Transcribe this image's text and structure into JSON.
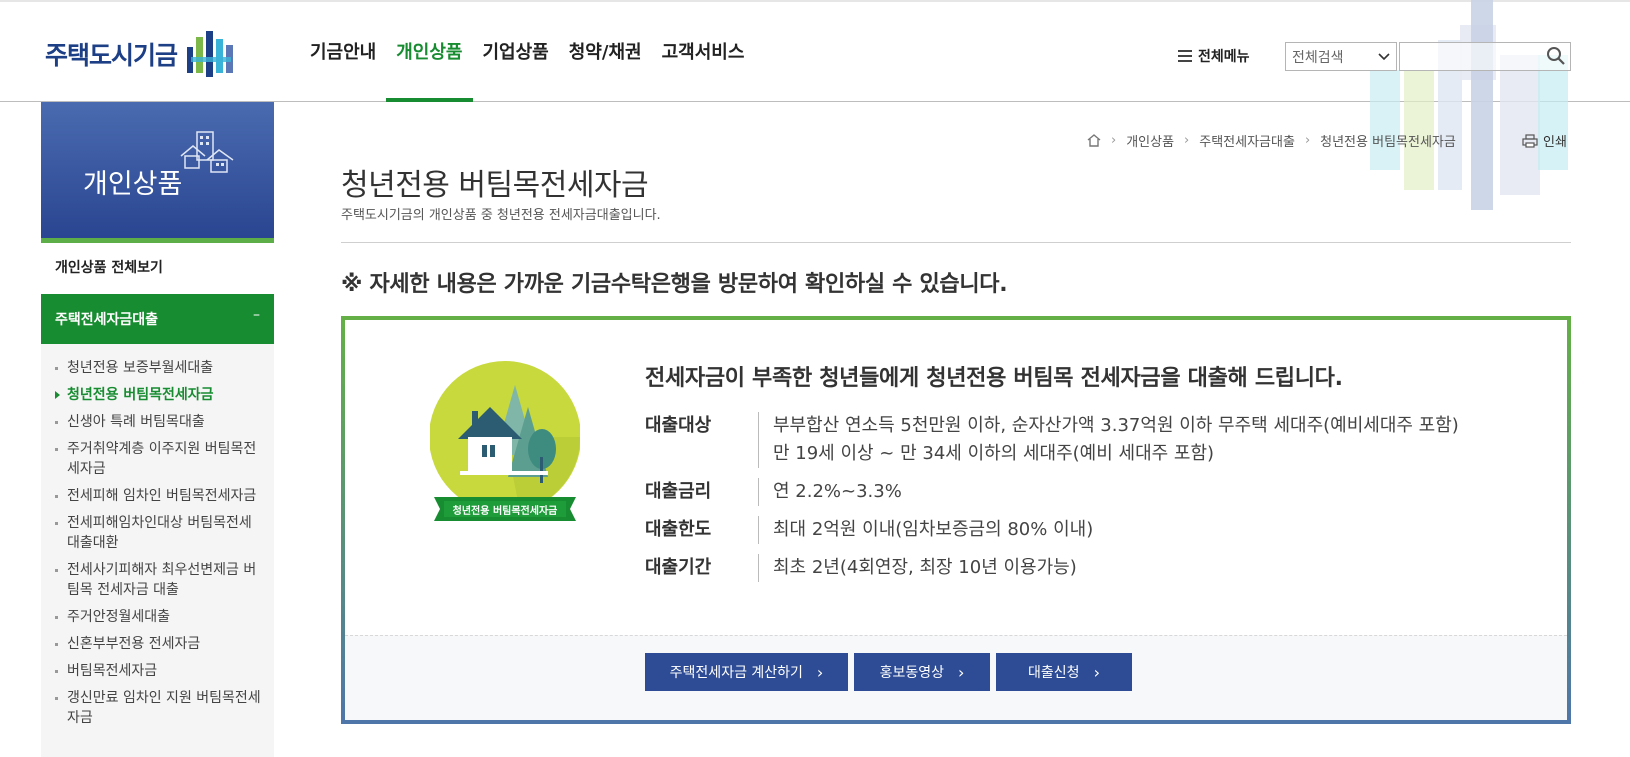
{
  "logo": {
    "text": "주택도시기금"
  },
  "gnb": [
    {
      "label": "기금안내"
    },
    {
      "label": "개인상품"
    },
    {
      "label": "기업상품"
    },
    {
      "label": "청약/채권"
    },
    {
      "label": "고객서비스"
    }
  ],
  "header": {
    "all_menu": "전체메뉴",
    "search_select": "전체검색",
    "search_placeholder": ""
  },
  "sidebar": {
    "title": "개인상품",
    "view_all": "개인상품 전체보기",
    "category": "주택전세자금대출",
    "category_toggle": "–",
    "items": [
      {
        "label": "청년전용 보증부월세대출"
      },
      {
        "label": "청년전용 버팀목전세자금"
      },
      {
        "label": "신생아 특례 버팀목대출"
      },
      {
        "label": "주거취약계층 이주지원 버팀목전세자금"
      },
      {
        "label": "전세피해 임차인 버팀목전세자금"
      },
      {
        "label": "전세피해임차인대상 버팀목전세대출대환"
      },
      {
        "label": "전세사기피해자 최우선변제금 버팀목 전세자금 대출"
      },
      {
        "label": "주거안정월세대출"
      },
      {
        "label": "신혼부부전용 전세자금"
      },
      {
        "label": "버팀목전세자금"
      },
      {
        "label": "갱신만료 임차인 지원 버팀목전세자금"
      }
    ]
  },
  "breadcrumb": [
    "개인상품",
    "주택전세자금대출",
    "청년전용 버팀목전세자금"
  ],
  "print_label": "인쇄",
  "page": {
    "title": "청년전용 버팀목전세자금",
    "desc": "주택도시기금의 개인상품 중 청년전용 전세자금대출입니다.",
    "notice": "※ 자세한 내용은 가까운 기금수탁은행을 방문하여 확인하실 수 있습니다."
  },
  "product": {
    "emblem_text": "청년전용 버팀목전세자금",
    "headline": "전세자금이 부족한 청년들에게 청년전용 버팀목 전세자금을 대출해 드립니다.",
    "rows": [
      {
        "label": "대출대상",
        "value1": "부부합산 연소득 5천만원 이하, 순자산가액 3.37억원 이하 무주택 세대주(예비세대주 포함)",
        "value2": "만 19세 이상 ~ 만 34세 이하의 세대주(예비 세대주 포함)"
      },
      {
        "label": "대출금리",
        "value1": "연 2.2%~3.3%"
      },
      {
        "label": "대출한도",
        "value1": "최대 2억원 이내(임차보증금의 80% 이내)"
      },
      {
        "label": "대출기간",
        "value1": "최초 2년(4회연장, 최장 10년 이용가능)"
      }
    ],
    "buttons": [
      {
        "label": "주택전세자금 계산하기"
      },
      {
        "label": "홍보동영상"
      },
      {
        "label": "대출신청"
      }
    ]
  },
  "colors": {
    "brand_green": "#188c31",
    "brand_blue": "#2d4c95"
  }
}
